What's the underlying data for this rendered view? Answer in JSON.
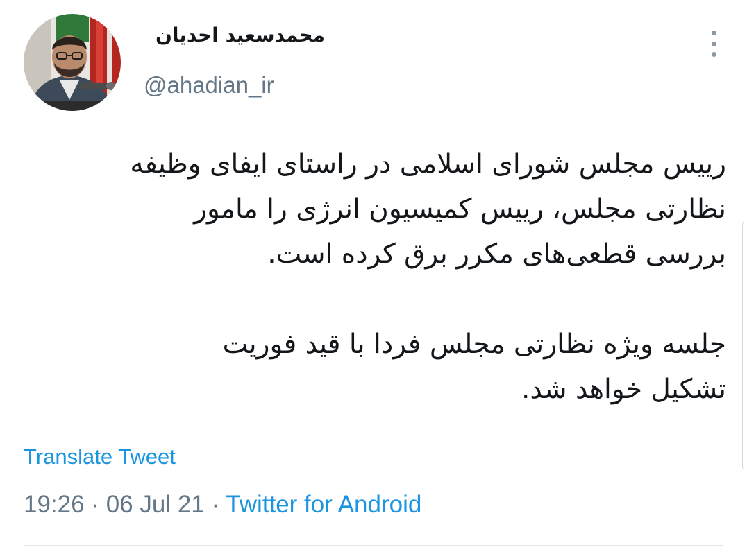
{
  "author": {
    "display_name": "محمدسعید احدیان",
    "handle": "@ahadian_ir"
  },
  "tweet": {
    "paragraphs": [
      "رییس مجلس شورای اسلامی در راستای ایفای وظیفه\nنظارتی مجلس، رییس کمیسیون انرژی را مامور\nبررسی قطعی‌های مکرر برق کرده است.",
      "جلسه ویژه نظارتی مجلس فردا با قید فوریت\nتشکیل خواهد شد."
    ],
    "translate_label": "Translate Tweet",
    "time": "19:26",
    "date": "06 Jul 21",
    "separator": "·",
    "source": "Twitter for Android"
  },
  "icons": {
    "more": "more-vertical-icon"
  },
  "colors": {
    "link": "#1b95e0",
    "secondary_text": "#657786",
    "primary_text": "#14171a"
  }
}
